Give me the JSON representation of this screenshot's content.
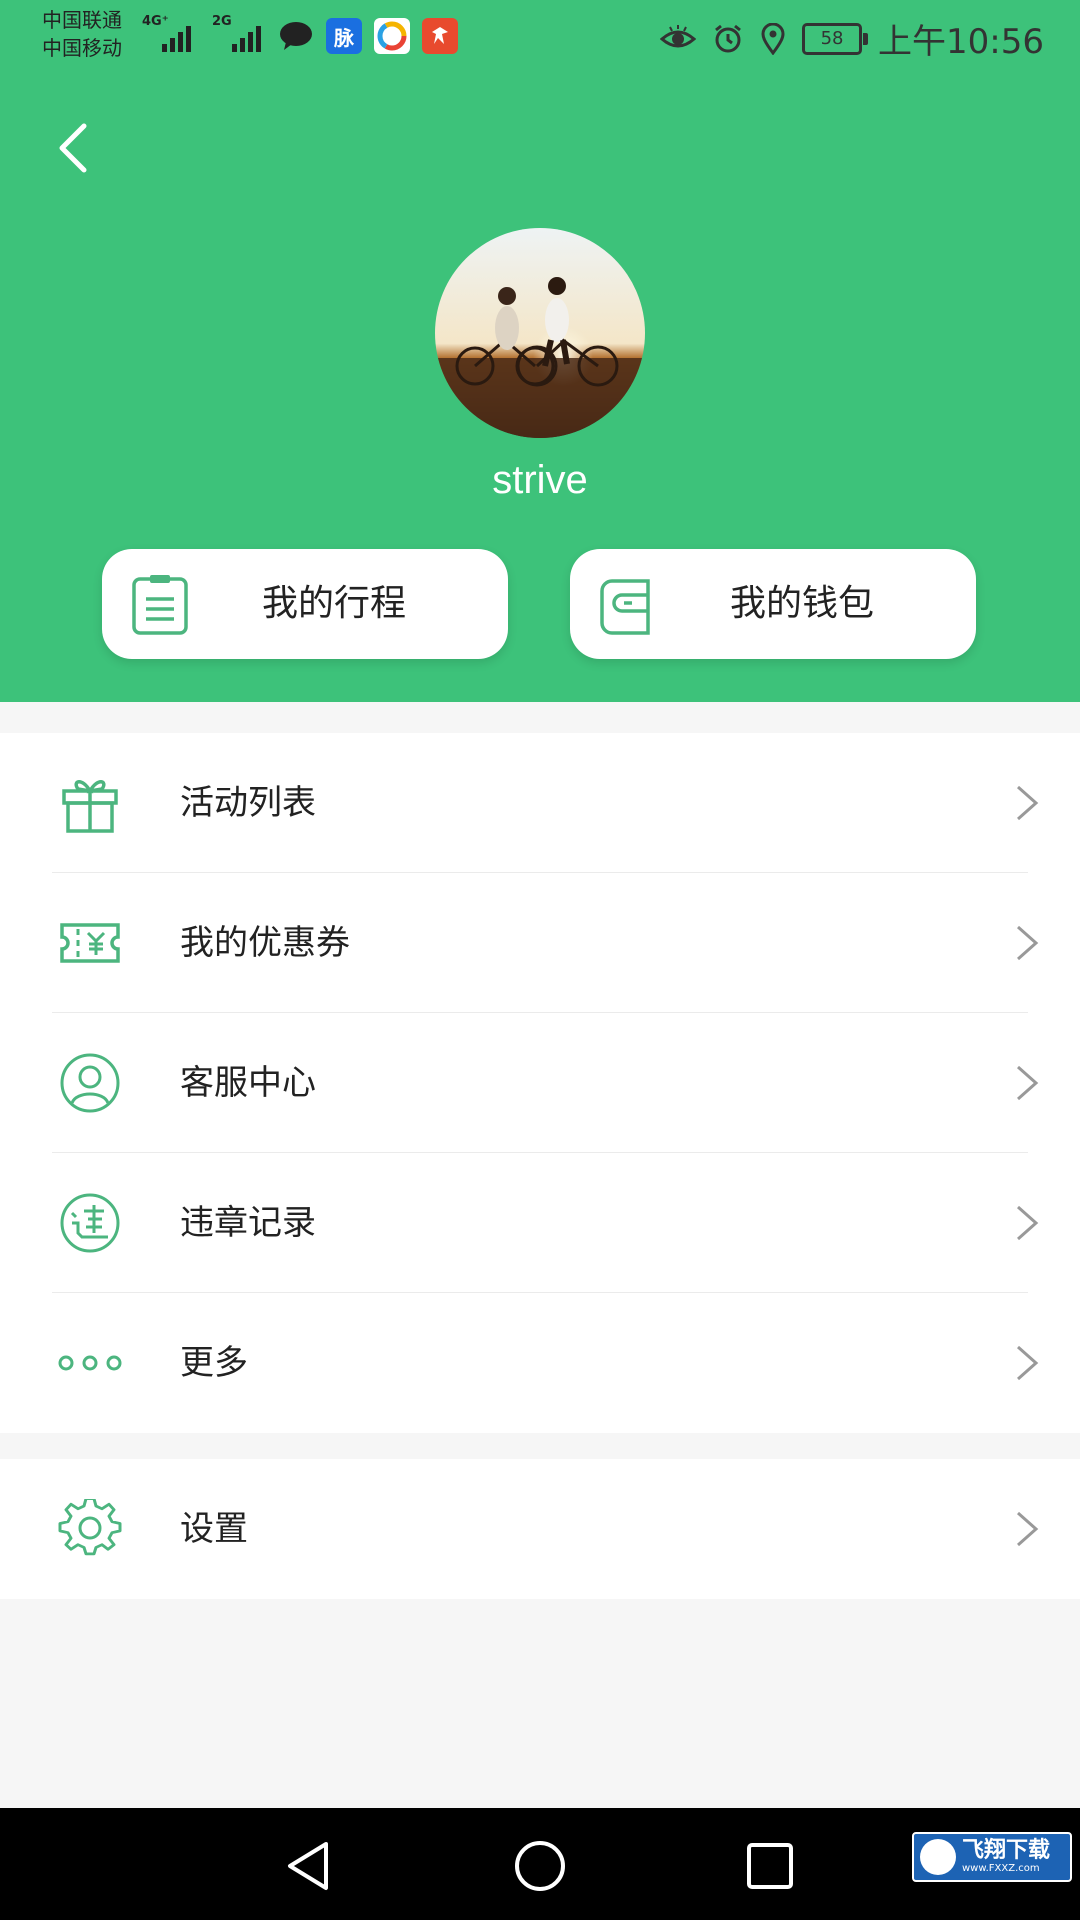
{
  "status_bar": {
    "carrier_1": "中国联通",
    "carrier_2": "中国移动",
    "net_1": "4G⁺",
    "net_2": "2G",
    "battery": "58",
    "time": "上午10:56",
    "app_maimai": "脉"
  },
  "profile": {
    "username": "strive"
  },
  "quick_actions": [
    {
      "label": "我的行程",
      "icon": "clipboard-icon"
    },
    {
      "label": "我的钱包",
      "icon": "wallet-icon"
    }
  ],
  "menu": [
    {
      "label": "活动列表",
      "icon": "gift-icon"
    },
    {
      "label": "我的优惠券",
      "icon": "coupon-icon"
    },
    {
      "label": "客服中心",
      "icon": "user-icon"
    },
    {
      "label": "违章记录",
      "icon": "violation-icon"
    },
    {
      "label": "更多",
      "icon": "more-icon"
    }
  ],
  "settings": {
    "label": "设置",
    "icon": "gear-icon"
  },
  "watermark": {
    "title": "飞翔下载",
    "site": "www.FXXZ.com"
  },
  "colors": {
    "accent": "#3dc27a",
    "icon_green": "#4cb57f"
  }
}
